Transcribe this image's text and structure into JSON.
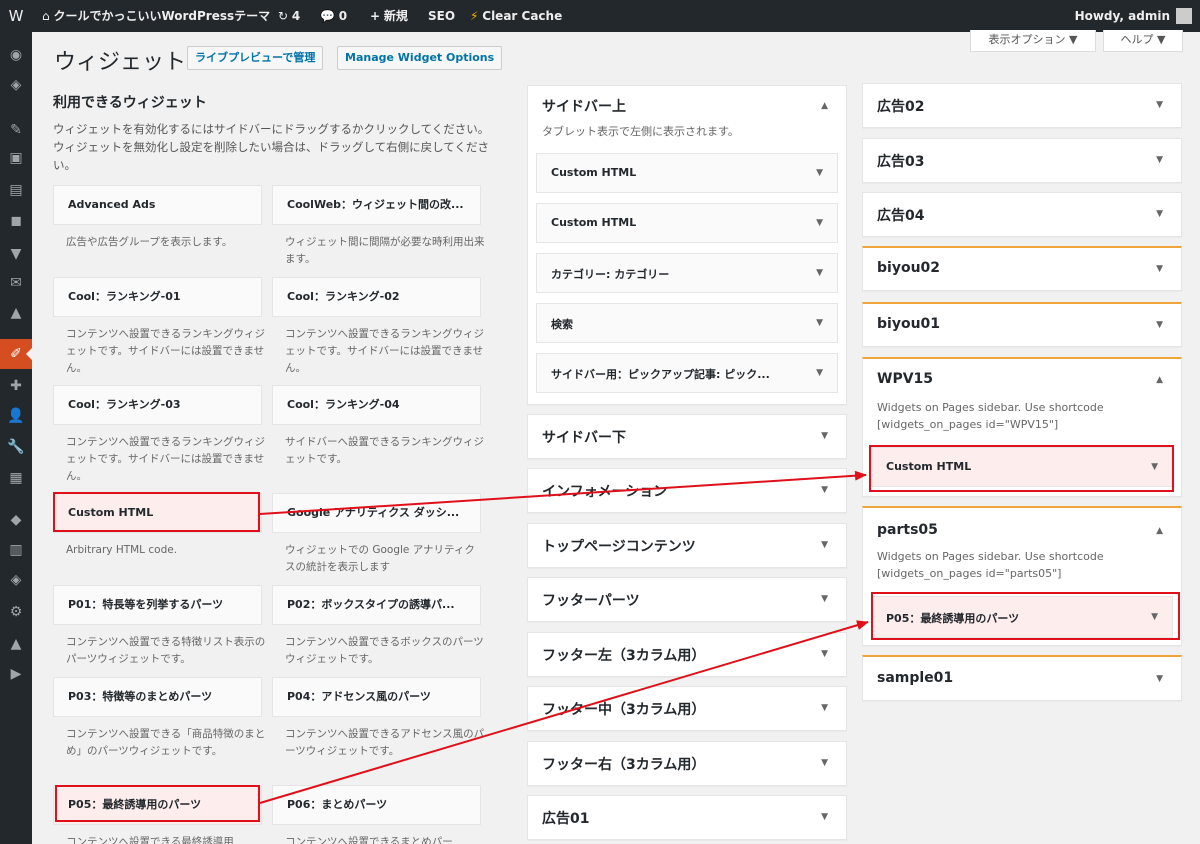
{
  "adminbar": {
    "wp_icon": "W",
    "home_icon": "⌂",
    "site_name": "クールでかっこいいWordPressテーマ",
    "updates_icon": "↻",
    "updates_count": "4",
    "comments_icon": "💬",
    "comments_count": "0",
    "new_icon": "+",
    "new_label": "新規",
    "seo_label": "SEO",
    "clear_cache_label": "Clear Cache",
    "howdy": "Howdy, admin"
  },
  "menu_icons": [
    "◉",
    "◈",
    "✎",
    "▣",
    "▤",
    "◼",
    "▼",
    "✉",
    "▲",
    "✐",
    "✚",
    "👤",
    "🔧",
    "▦",
    "◆",
    "▥",
    "◈",
    "⚙",
    "▲",
    "▶"
  ],
  "header": {
    "title": "ウィジェット",
    "live_preview_btn": "ライブプレビューで管理",
    "manage_options_btn": "Manage Widget Options",
    "screen_options": "表示オプション ▼",
    "help": "ヘルプ ▼"
  },
  "available": {
    "title": "利用できるウィジェット",
    "desc": "ウィジェットを有効化するにはサイドバーにドラッグするかクリックしてください。ウィジェットを無効化し設定を削除したい場合は、ドラッグして右側に戻してください。",
    "widgets": [
      {
        "name": "Advanced Ads",
        "desc": "広告や広告グループを表示します。"
      },
      {
        "name": "CoolWeb：ウィジェット間の改...",
        "desc": "ウィジェット間に間隔が必要な時利用出来ます。"
      },
      {
        "name": "Cool：ランキング-01",
        "desc": "コンテンツへ設置できるランキングウィジェットです。サイドバーには設置できません。"
      },
      {
        "name": "Cool：ランキング-02",
        "desc": "コンテンツへ設置できるランキングウィジェットです。サイドバーには設置できません。"
      },
      {
        "name": "Cool：ランキング-03",
        "desc": "コンテンツへ設置できるランキングウィジェットです。サイドバーには設置できません。"
      },
      {
        "name": "Cool：ランキング-04",
        "desc": "サイドバーへ設置できるランキングウィジェットです。"
      },
      {
        "name": "Custom HTML",
        "desc": "Arbitrary HTML code."
      },
      {
        "name": "Google アナリティクス ダッシ...",
        "desc": "ウィジェットでの Google アナリティクスの統計を表示します"
      },
      {
        "name": "P01：特長等を列挙するパーツ",
        "desc": "コンテンツへ設置できる特徴リスト表示のパーツウィジェットです。"
      },
      {
        "name": "P02：ボックスタイプの誘導パ...",
        "desc": "コンテンツへ設置できるボックスのパーツウィジェットです。"
      },
      {
        "name": "P03：特徴等のまとめパーツ",
        "desc": "コンテンツへ設置できる「商品特徴のまとめ」のパーツウィジェットです。"
      },
      {
        "name": "P04：アドセンス風のパーツ",
        "desc": "コンテンツへ設置できるアドセンス風のパーツウィジェットです。"
      },
      {
        "name": "P05：最終誘導用のパーツ",
        "desc": "コンテンツへ設置できる最終誘導用"
      },
      {
        "name": "P06：まとめパーツ",
        "desc": "コンテンツへ設置できるまとめパー"
      }
    ]
  },
  "middle": {
    "sidebar_top": {
      "title": "サイドバー上",
      "desc": "タブレット表示で左側に表示されます。",
      "widgets": [
        "Custom HTML",
        "Custom HTML",
        "カテゴリー: カテゴリー",
        "検索",
        "サイドバー用：ピックアップ記事: ピック..."
      ]
    },
    "areas": [
      "サイドバー下",
      "インフォメーション",
      "トップページコンテンツ",
      "フッターパーツ",
      "フッター左（3カラム用）",
      "フッター中（3カラム用）",
      "フッター右（3カラム用）",
      "広告01"
    ]
  },
  "right": {
    "areas_top": [
      "広告02",
      "広告03",
      "広告04",
      "biyou02",
      "biyou01"
    ],
    "wpv15": {
      "title": "WPV15",
      "desc1": "Widgets on Pages sidebar. Use shortcode",
      "desc2": "[widgets_on_pages id=\"WPV15\"]",
      "widget": "Custom HTML"
    },
    "parts05": {
      "title": "parts05",
      "desc1": "Widgets on Pages sidebar. Use shortcode",
      "desc2": "[widgets_on_pages id=\"parts05\"]",
      "widget": "P05：最終誘導用のパーツ"
    },
    "sample": "sample01"
  },
  "arrow_down": "▼",
  "arrow_up": "▲",
  "colors": {
    "adminbar": "#23282d",
    "active_menu": "#d54e21",
    "highlight_box": "#e0101a",
    "accent_border": "#f0a43c"
  }
}
